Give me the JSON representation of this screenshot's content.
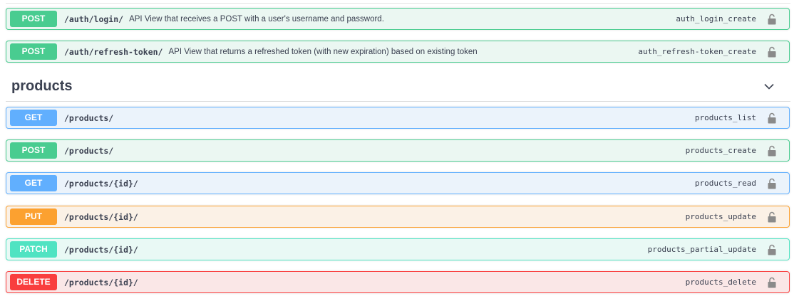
{
  "auth_operations": [
    {
      "method": "POST",
      "path": "/auth/login/",
      "summary": "API View that receives a POST with a user's username and password.",
      "operation_id": "auth_login_create",
      "icon": "lock-icon"
    },
    {
      "method": "POST",
      "path": "/auth/refresh-token/",
      "summary": "API View that returns a refreshed token (with new expiration) based on existing token",
      "operation_id": "auth_refresh-token_create",
      "icon": "lock-icon"
    }
  ],
  "products_section": {
    "title": "products",
    "toggle_icon": "chevron-down-icon",
    "operations": [
      {
        "method": "GET",
        "path": "/products/",
        "operation_id": "products_list",
        "icon": "lock-icon"
      },
      {
        "method": "POST",
        "path": "/products/",
        "operation_id": "products_create",
        "icon": "lock-icon"
      },
      {
        "method": "GET",
        "path": "/products/{id}/",
        "operation_id": "products_read",
        "icon": "lock-icon"
      },
      {
        "method": "PUT",
        "path": "/products/{id}/",
        "operation_id": "products_update",
        "icon": "lock-icon"
      },
      {
        "method": "PATCH",
        "path": "/products/{id}/",
        "operation_id": "products_partial_update",
        "icon": "lock-icon"
      },
      {
        "method": "DELETE",
        "path": "/products/{id}/",
        "operation_id": "products_delete",
        "icon": "lock-icon"
      }
    ]
  },
  "colors": {
    "post": "#49cc90",
    "get": "#61affe",
    "put": "#fca130",
    "patch": "#50e3c2",
    "delete": "#f93e3e",
    "text": "#3b4151"
  }
}
